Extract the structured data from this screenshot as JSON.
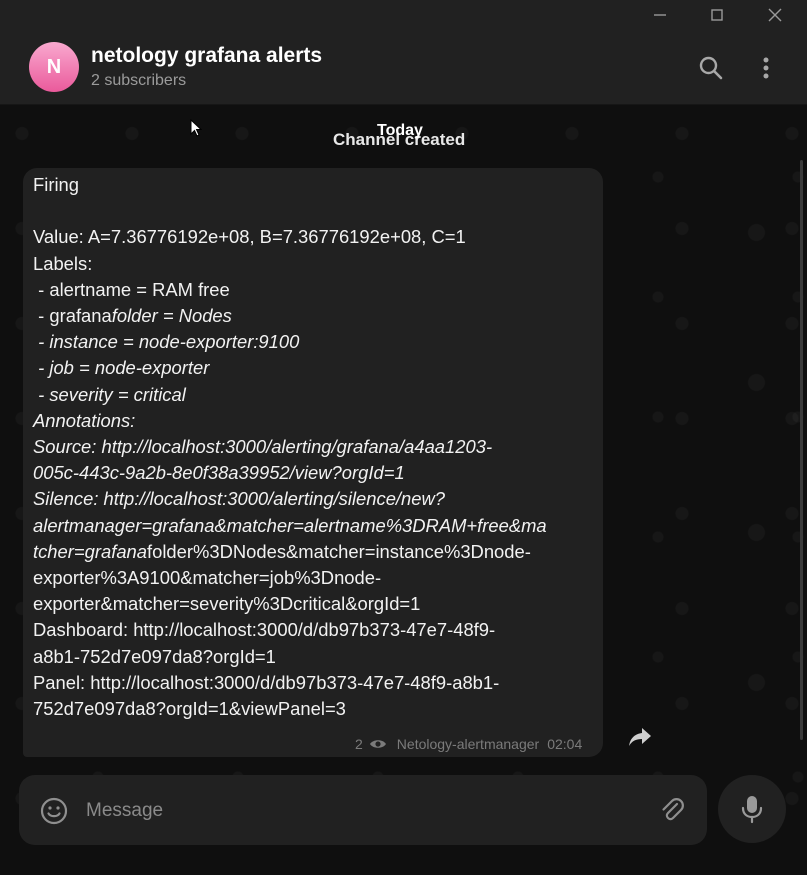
{
  "window": {
    "controls": [
      "minimize",
      "maximize",
      "close"
    ]
  },
  "header": {
    "avatar_letter": "N",
    "title": "netology grafana alerts",
    "subtitle": "2 subscribers",
    "icons": [
      "search-icon",
      "more-vertical-icon"
    ]
  },
  "chat": {
    "service_message": "Channel created",
    "date_label": "Today",
    "message": {
      "lines": [
        {
          "parts": [
            {
              "t": "Firing",
              "i": false
            }
          ]
        },
        {
          "parts": [
            {
              "t": "",
              "i": false
            }
          ]
        },
        {
          "parts": [
            {
              "t": "Value: A=7.36776192e+08, B=7.36776192e+08, C=1",
              "i": false
            }
          ]
        },
        {
          "parts": [
            {
              "t": "Labels:",
              "i": false
            }
          ]
        },
        {
          "parts": [
            {
              "t": " - alertname = RAM free",
              "i": false
            }
          ]
        },
        {
          "parts": [
            {
              "t": " - grafana",
              "i": false
            },
            {
              "t": "folder = Nodes",
              "i": true
            }
          ]
        },
        {
          "parts": [
            {
              "t": " - instance = node-exporter:9100",
              "i": true
            }
          ]
        },
        {
          "parts": [
            {
              "t": " - job = node-exporter",
              "i": true
            }
          ]
        },
        {
          "parts": [
            {
              "t": " - severity = critical",
              "i": true
            }
          ]
        },
        {
          "parts": [
            {
              "t": "Annotations:",
              "i": true
            }
          ]
        },
        {
          "parts": [
            {
              "t": "Source: http://localhost:3000/alerting/grafana/a4aa1203-",
              "i": true
            }
          ]
        },
        {
          "parts": [
            {
              "t": "005c-443c-9a2b-8e0f38a39952/view?orgId=1",
              "i": true
            }
          ]
        },
        {
          "parts": [
            {
              "t": "Silence: http://localhost:3000/alerting/silence/new?",
              "i": true
            }
          ]
        },
        {
          "parts": [
            {
              "t": "alertmanager=grafana&matcher=alertname%3DRAM+free&ma",
              "i": true
            }
          ]
        },
        {
          "parts": [
            {
              "t": "tcher=grafana",
              "i": true
            },
            {
              "t": "folder%3DNodes&matcher=instance%3Dnode-",
              "i": false
            }
          ]
        },
        {
          "parts": [
            {
              "t": "exporter%3A9100&matcher=job%3Dnode-",
              "i": false
            }
          ]
        },
        {
          "parts": [
            {
              "t": "exporter&matcher=severity%3Dcritical&orgId=1",
              "i": false
            }
          ]
        },
        {
          "parts": [
            {
              "t": "Dashboard: http://localhost:3000/d/db97b373-47e7-48f9-",
              "i": false
            }
          ]
        },
        {
          "parts": [
            {
              "t": "a8b1-752d7e097da8?orgId=1",
              "i": false
            }
          ]
        },
        {
          "parts": [
            {
              "t": "Panel: http://localhost:3000/d/db97b373-47e7-48f9-a8b1-",
              "i": false
            }
          ]
        },
        {
          "parts": [
            {
              "t": "752d7e097da8?orgId=1&viewPanel=3",
              "i": false
            }
          ]
        }
      ],
      "views": "2",
      "author": "Netology-alertmanager",
      "time": "02:04"
    }
  },
  "composer": {
    "placeholder": "Message",
    "icons": [
      "emoji-icon",
      "attach-icon",
      "microphone-icon"
    ]
  },
  "colors": {
    "bg": "#0e0e0e",
    "panel": "#212121",
    "avatar_top": "#f9a9cf",
    "avatar_bottom": "#ea5a9b",
    "muted": "#9b9b9b"
  }
}
